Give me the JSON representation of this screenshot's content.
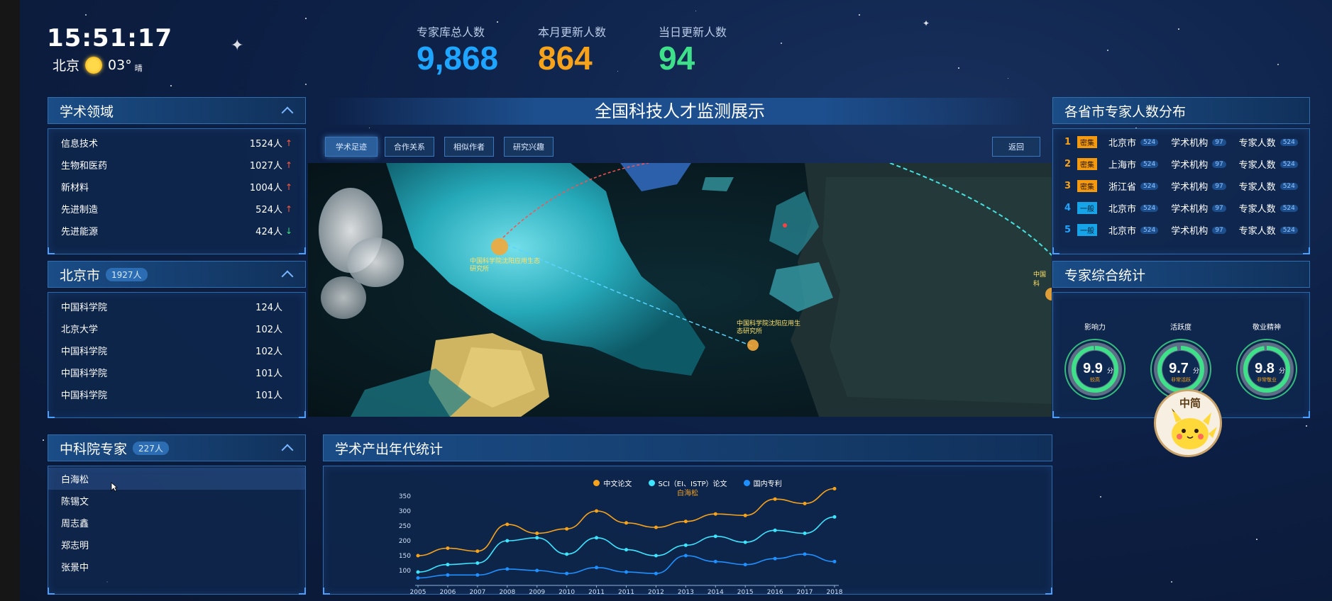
{
  "clock": {
    "time": "15:51:17",
    "city": "北京",
    "temp": "03°",
    "condition": "晴",
    "weather_icon": "sun-icon"
  },
  "stats": [
    {
      "label": "专家库总人数",
      "value": "9,868",
      "color": "#1ea5ff"
    },
    {
      "label": "本月更新人数",
      "value": "864",
      "color": "#f7a21b"
    },
    {
      "label": "当日更新人数",
      "value": "94",
      "color": "#3fe08a"
    }
  ],
  "fields": {
    "title": "学术领域",
    "items": [
      {
        "name": "信息技术",
        "count": "1524人",
        "trend": "up"
      },
      {
        "name": "生物和医药",
        "count": "1027人",
        "trend": "up"
      },
      {
        "name": "新材料",
        "count": "1004人",
        "trend": "up"
      },
      {
        "name": "先进制造",
        "count": "524人",
        "trend": "up"
      },
      {
        "name": "先进能源",
        "count": "424人",
        "trend": "down"
      }
    ]
  },
  "city": {
    "title": "北京市",
    "badge": "1927人",
    "items": [
      {
        "name": "中国科学院",
        "count": "124人"
      },
      {
        "name": "北京大学",
        "count": "102人"
      },
      {
        "name": "中国科学院",
        "count": "102人"
      },
      {
        "name": "中国科学院",
        "count": "101人"
      },
      {
        "name": "中国科学院",
        "count": "101人"
      }
    ]
  },
  "cas": {
    "title": "中科院专家",
    "badge": "227人",
    "items": [
      "白海松",
      "陈锡文",
      "周志鑫",
      "郑志明",
      "张景中"
    ]
  },
  "center": {
    "title": "全国科技人才监测展示",
    "tabs": [
      "学术足迹",
      "合作关系",
      "相似作者",
      "研究兴趣"
    ],
    "back": "返回",
    "map_labels": [
      "中国科学院沈阳应用生态研究所",
      "中国科学院沈阳应用生态研究所",
      "中国科"
    ]
  },
  "provinces": {
    "title": "各省市专家人数分布",
    "rows": [
      {
        "rank": "1",
        "tag": "密集",
        "tag_type": "dense",
        "city": "北京市",
        "c1": "524",
        "inst_label": "学术机构",
        "c2": "97",
        "exp_label": "专家人数",
        "c3": "524"
      },
      {
        "rank": "2",
        "tag": "密集",
        "tag_type": "dense",
        "city": "上海市",
        "c1": "524",
        "inst_label": "学术机构",
        "c2": "97",
        "exp_label": "专家人数",
        "c3": "524"
      },
      {
        "rank": "3",
        "tag": "密集",
        "tag_type": "dense",
        "city": "浙江省",
        "c1": "524",
        "inst_label": "学术机构",
        "c2": "97",
        "exp_label": "专家人数",
        "c3": "524"
      },
      {
        "rank": "4",
        "tag": "一般",
        "tag_type": "normal",
        "city": "北京市",
        "c1": "524",
        "inst_label": "学术机构",
        "c2": "97",
        "exp_label": "专家人数",
        "c3": "524"
      },
      {
        "rank": "5",
        "tag": "一般",
        "tag_type": "normal",
        "city": "北京市",
        "c1": "524",
        "inst_label": "学术机构",
        "c2": "97",
        "exp_label": "专家人数",
        "c3": "524"
      }
    ]
  },
  "scores": {
    "title": "专家综合统计",
    "items": [
      {
        "label": "影响力",
        "score": "9.9",
        "unit": "分",
        "desc": "较高",
        "value": 9.9
      },
      {
        "label": "活跃度",
        "score": "9.7",
        "unit": "分",
        "desc": "非常活跃",
        "value": 9.7
      },
      {
        "label": "敬业精神",
        "score": "9.8",
        "unit": "分",
        "desc": "非常敬业",
        "value": 9.8
      }
    ]
  },
  "output_chart": {
    "title": "学术产出年代统计",
    "chart_data": {
      "type": "line",
      "title": "白海松",
      "categories": [
        "2005",
        "2006",
        "2007",
        "2008",
        "2009",
        "2010",
        "2011",
        "2011",
        "2012",
        "2013",
        "2014",
        "2015",
        "2016",
        "2017",
        "2018"
      ],
      "ylim": [
        50,
        350
      ],
      "yticks": [
        "350",
        "300",
        "250",
        "200",
        "150",
        "100"
      ],
      "series": [
        {
          "name": "中文论文",
          "color": "#f7a21b",
          "values": [
            150,
            175,
            165,
            255,
            225,
            240,
            300,
            260,
            245,
            265,
            290,
            285,
            340,
            325,
            375
          ]
        },
        {
          "name": "SCI（EI、ISTP）论文",
          "color": "#3ee5ff",
          "values": [
            95,
            120,
            125,
            200,
            210,
            155,
            210,
            170,
            150,
            185,
            215,
            195,
            235,
            225,
            280
          ]
        },
        {
          "name": "国内专利",
          "color": "#1e90ff",
          "values": [
            75,
            85,
            85,
            105,
            100,
            90,
            110,
            95,
            90,
            150,
            130,
            120,
            140,
            155,
            130
          ]
        }
      ],
      "grid": false,
      "legend": "top"
    }
  }
}
